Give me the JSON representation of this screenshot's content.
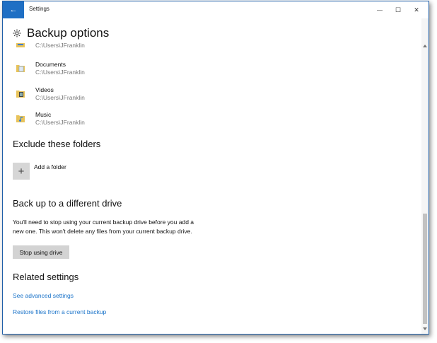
{
  "window": {
    "title": "Settings",
    "back_label": "←",
    "minimize": "—",
    "maximize": "☐",
    "close": "✕"
  },
  "page": {
    "title": "Backup options"
  },
  "folders": [
    {
      "name": "",
      "path": "C:\\Users\\JFranklin",
      "icon": "folder-icon"
    },
    {
      "name": "Documents",
      "path": "C:\\Users\\JFranklin",
      "icon": "documents-folder-icon"
    },
    {
      "name": "Videos",
      "path": "C:\\Users\\JFranklin",
      "icon": "videos-folder-icon"
    },
    {
      "name": "Music",
      "path": "C:\\Users\\JFranklin",
      "icon": "music-folder-icon"
    }
  ],
  "exclude": {
    "title": "Exclude these folders",
    "add_label": "Add a folder",
    "add_icon": "+"
  },
  "drive": {
    "title": "Back up to a different drive",
    "description": "You'll need to stop using your current backup drive before you add a new one. This won't delete any files from your current backup drive.",
    "stop_button": "Stop using drive"
  },
  "related": {
    "title": "Related settings",
    "link_advanced": "See advanced settings",
    "link_restore": "Restore files from a current backup"
  },
  "colors": {
    "accent": "#1f6fc4",
    "link": "#1a73c9"
  }
}
